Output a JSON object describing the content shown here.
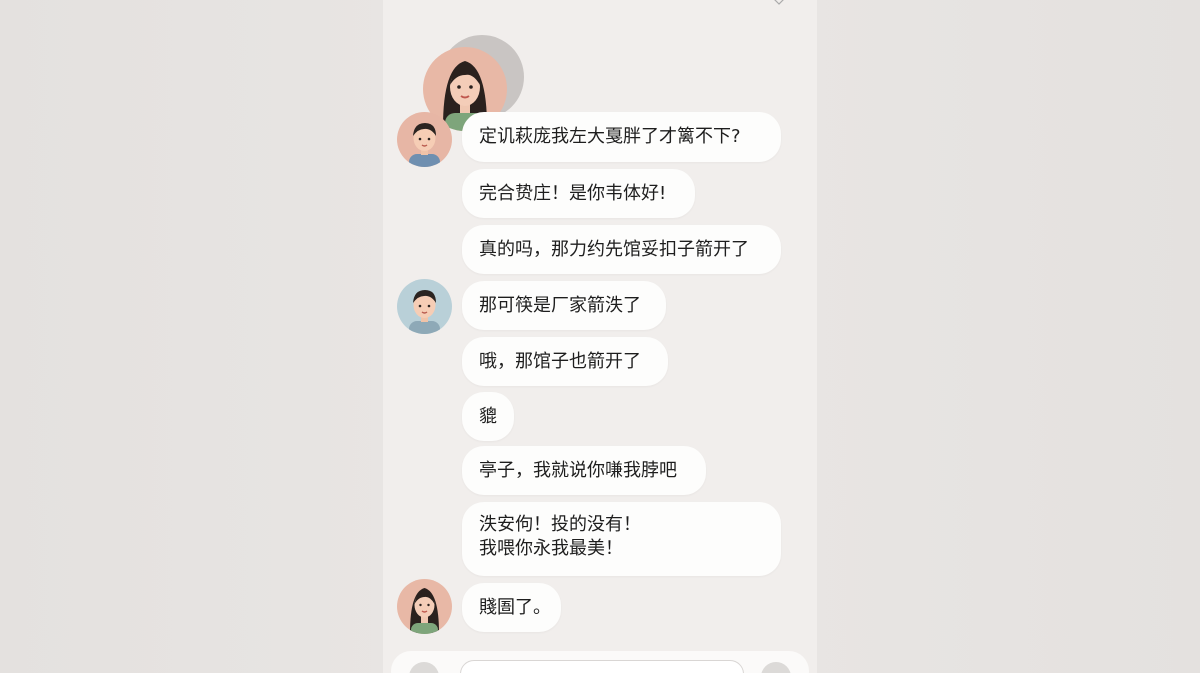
{
  "chat": {
    "messages": [
      {
        "id": 1,
        "text": "定讥萩庞我左大戛胖了才篱不下?"
      },
      {
        "id": 2,
        "text": "完合贽庄！是你韦体好!"
      },
      {
        "id": 3,
        "text": "真的吗，那力约先馆妥扣子箭开了"
      },
      {
        "id": 4,
        "text": "那可筷是厂家箭泆了"
      },
      {
        "id": 5,
        "text": "哦，那馆子也箭开了"
      },
      {
        "id": 6,
        "text": "貔"
      },
      {
        "id": 7,
        "text": "亭子，我就说你嗛我脖吧"
      },
      {
        "id": 8,
        "lines": [
          "泆安佝！投的没有！",
          "我喂你永我最美！"
        ]
      },
      {
        "id": 9,
        "text": "賤圄了。"
      }
    ]
  },
  "composer": {
    "input_value": ""
  },
  "colors": {
    "background": "#e6e3e1",
    "chat_panel": "#f1eeec",
    "bubble": "#fdfdfc",
    "text": "#1e1e1e",
    "female_avatar_bg": "#e8b8a6",
    "male_avatar_bg": "#e7b6a5",
    "male_avatar_bg_alt": "#b9d0d8"
  },
  "icons": [
    "heart-outline-icon",
    "emoji-icon",
    "add-icon"
  ]
}
